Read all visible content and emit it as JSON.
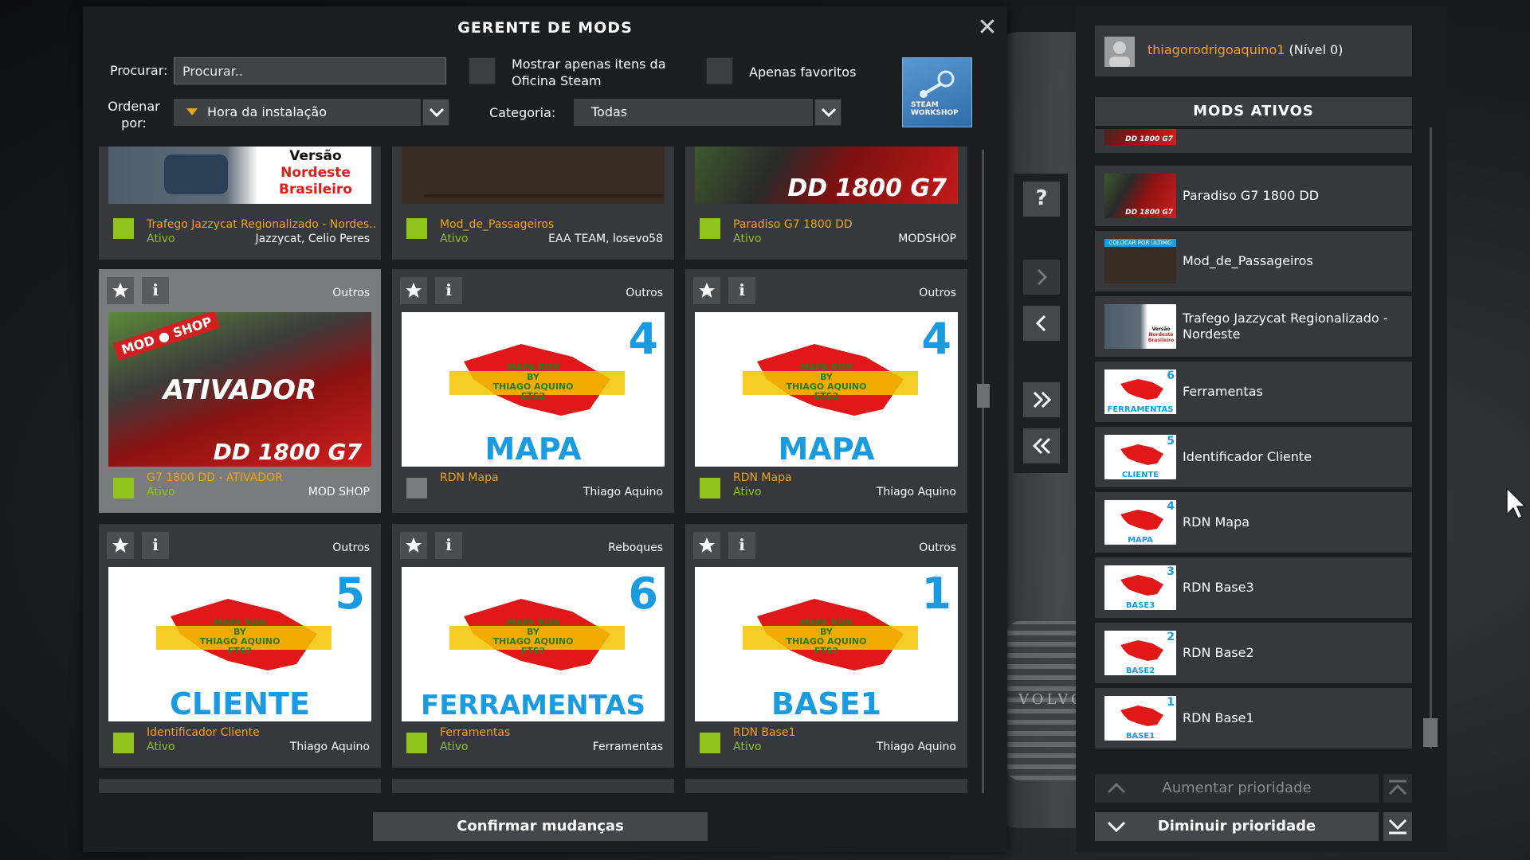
{
  "window": {
    "title": "GERENTE DE MODS"
  },
  "filters": {
    "search_label": "Procurar:",
    "search_placeholder": "Procurar..",
    "workshop_only_label": "Mostrar apenas itens da Oficina Steam",
    "favorites_only_label": "Apenas favoritos",
    "sort_label": "Ordenar por:",
    "sort_value": "Hora da instalação",
    "category_label": "Categoria:",
    "category_value": "Todas",
    "workshop_button_text": "STEAM WORKSHOP"
  },
  "top_row": [
    {
      "name": "Trafego Jazzycat Regionalizado - Nordes..",
      "status": "Ativo",
      "author": "Jazzycat, Celio Peres",
      "thumb_text": [
        "Versão",
        "Nordeste",
        "Brasileiro"
      ]
    },
    {
      "name": "Mod_de_Passageiros",
      "status": "Ativo",
      "author": "EAA TEAM, losevo58"
    },
    {
      "name": "Paradiso G7 1800 DD",
      "status": "Ativo",
      "author": "MODSHOP",
      "thumb_text": [
        "DD 1800 G7"
      ]
    }
  ],
  "cards": [
    {
      "category": "Outros",
      "name": "G7 1800 DD - ATIVADOR",
      "status": "Ativo",
      "author": "MOD SHOP",
      "active": true,
      "thumb_type": "bus",
      "thumb_text": [
        "MOD",
        "SHOP",
        "ATIVADOR",
        "DD 1800 G7"
      ]
    },
    {
      "category": "Outros",
      "name": "RDN Mapa",
      "status": "",
      "author": "Thiago Aquino",
      "active": false,
      "thumb_type": "map",
      "thumb_text": [
        "4",
        "MAPA",
        "MAPA RDN",
        "BY",
        "THIAGO AQUINO",
        "ETS2"
      ]
    },
    {
      "category": "Outros",
      "name": "RDN Mapa",
      "status": "Ativo",
      "author": "Thiago Aquino",
      "active": true,
      "thumb_type": "map",
      "thumb_text": [
        "4",
        "MAPA",
        "MAPA RDN",
        "BY",
        "THIAGO AQUINO",
        "ETS2"
      ]
    },
    {
      "category": "Outros",
      "name": "Identificador Cliente",
      "status": "Ativo",
      "author": "Thiago Aquino",
      "active": true,
      "thumb_type": "map",
      "thumb_text": [
        "5",
        "CLIENTE",
        "MAPA RDN",
        "BY",
        "THIAGO AQUINO",
        "ETS2"
      ]
    },
    {
      "category": "Reboques",
      "name": "Ferramentas",
      "status": "Ativo",
      "author": "Ferramentas",
      "active": true,
      "thumb_type": "map",
      "thumb_text": [
        "6",
        "FERRAMENTAS",
        "MAPA RDN",
        "BY",
        "THIAGO AQUINO",
        "ETS2"
      ]
    },
    {
      "category": "Outros",
      "name": "RDN Base1",
      "status": "Ativo",
      "author": "Thiago Aquino",
      "active": true,
      "thumb_type": "map",
      "thumb_text": [
        "1",
        "BASE1",
        "MAPA RDN",
        "BY",
        "THIAGO AQUINO",
        "ETS2"
      ]
    }
  ],
  "confirm_label": "Confirmar mudanças",
  "middle_controls": {
    "help": "?"
  },
  "user": {
    "name": "thiagorodrigoaquino1",
    "level": "(Nível 0)"
  },
  "active_mods_header": "MODS ATIVOS",
  "active_mods": [
    {
      "name": "",
      "thumb": "bus",
      "thumb_text": [
        "DD 1800 G7"
      ]
    },
    {
      "name": "Paradiso G7 1800 DD",
      "thumb": "bus",
      "thumb_text": [
        "DD 1800 G7"
      ]
    },
    {
      "name": "Mod_de_Passageiros",
      "thumb": "dark",
      "thumb_text": [
        "COLOCAR POR ÚLTIMO"
      ]
    },
    {
      "name": "Trafego Jazzycat Regionalizado - Nordeste",
      "thumb": "car",
      "thumb_text": [
        "Versão",
        "Nordeste",
        "Brasileiro"
      ]
    },
    {
      "name": "Ferramentas",
      "thumb": "map",
      "thumb_text": [
        "6",
        "FERRAMENTAS"
      ]
    },
    {
      "name": "Identificador Cliente",
      "thumb": "map",
      "thumb_text": [
        "5",
        "CLIENTE"
      ]
    },
    {
      "name": "RDN Mapa",
      "thumb": "map",
      "thumb_text": [
        "4",
        "MAPA"
      ]
    },
    {
      "name": "RDN Base3",
      "thumb": "map",
      "thumb_text": [
        "3",
        "BASE3"
      ]
    },
    {
      "name": "RDN Base2",
      "thumb": "map",
      "thumb_text": [
        "2",
        "BASE2"
      ]
    },
    {
      "name": "RDN Base1",
      "thumb": "map",
      "thumb_text": [
        "1",
        "BASE1"
      ]
    }
  ],
  "priority": {
    "increase": "Aumentar prioridade",
    "decrease": "Diminuir prioridade"
  },
  "background": {
    "brand": "VOLVO"
  },
  "colors": {
    "accent_orange": "#f0a419",
    "active_green": "#8fc41f",
    "panel": "#1c1d1f",
    "card": "#36383b"
  }
}
